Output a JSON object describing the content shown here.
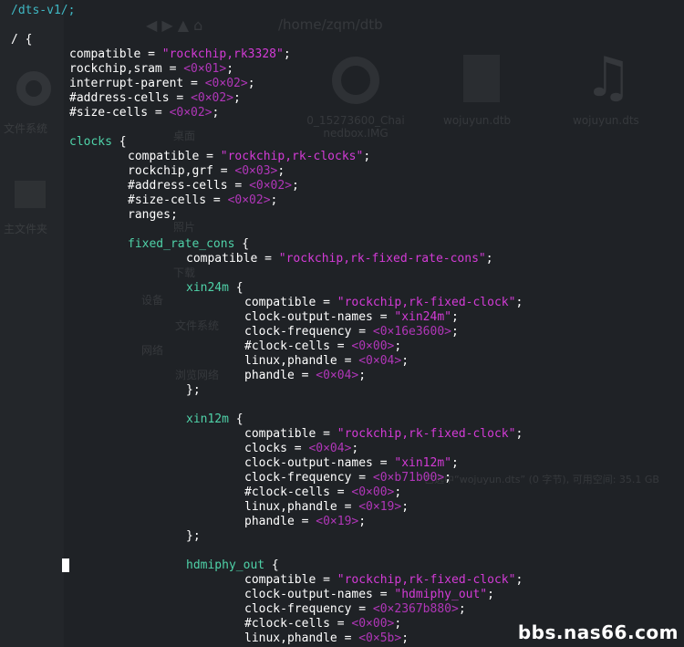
{
  "header_line": "/dts-v1/;",
  "root_open": "/ {",
  "background_ghost": {
    "path": "/home/zqm/dtb",
    "files": [
      "0_15273600_Chai nedbox.IMG",
      "wojuyun.dtb",
      "wojuyun.dts"
    ],
    "sidebar": [
      "文件系统",
      "主文件夹"
    ],
    "places": [
      "桌面",
      "设备",
      "文件系统",
      "网络",
      "浏览网络",
      "照片",
      "下载"
    ],
    "status": "已选中“wojuyun.dts” (0 字节), 可用空间: 35.1 GB"
  },
  "lines": [
    {
      "key": "compatible",
      "val": "\"rockchip,rk3328\"",
      "type": "str"
    },
    {
      "key": "rockchip,sram",
      "val": "<0×01>",
      "type": "num"
    },
    {
      "key": "interrupt-parent",
      "val": "<0×02>",
      "type": "num"
    },
    {
      "key": "#address-cells",
      "val": "<0×02>",
      "type": "num"
    },
    {
      "key": "#size-cells",
      "val": "<0×02>",
      "type": "num"
    },
    {
      "node": "clocks"
    },
    {
      "key": "compatible",
      "val": "\"rockchip,rk-clocks\"",
      "type": "str"
    },
    {
      "key": "rockchip,grf",
      "val": "<0×03>",
      "type": "num"
    },
    {
      "key": "#address-cells",
      "val": "<0×02>",
      "type": "num"
    },
    {
      "key": "#size-cells",
      "val": "<0×02>",
      "type": "num"
    },
    {
      "plain": "ranges;"
    },
    {
      "node": "fixed_rate_cons"
    },
    {
      "key": "compatible",
      "val": "\"rockchip,rk-fixed-rate-cons\"",
      "type": "str"
    },
    {
      "node": "xin24m"
    },
    {
      "key": "compatible",
      "val": "\"rockchip,rk-fixed-clock\"",
      "type": "str"
    },
    {
      "key": "clock-output-names",
      "val": "\"xin24m\"",
      "type": "str"
    },
    {
      "key": "clock-frequency",
      "val": "<0×16e3600>",
      "type": "num"
    },
    {
      "key": "#clock-cells",
      "val": "<0×00>",
      "type": "num"
    },
    {
      "key": "linux,phandle",
      "val": "<0×04>",
      "type": "num"
    },
    {
      "key": "phandle",
      "val": "<0×04>",
      "type": "num"
    },
    {
      "plain": "};"
    },
    {
      "node": "xin12m"
    },
    {
      "key": "compatible",
      "val": "\"rockchip,rk-fixed-clock\"",
      "type": "str"
    },
    {
      "key": "clocks",
      "val": "<0×04>",
      "type": "num"
    },
    {
      "key": "clock-output-names",
      "val": "\"xin12m\"",
      "type": "str"
    },
    {
      "key": "clock-frequency",
      "val": "<0×b71b00>",
      "type": "num"
    },
    {
      "key": "#clock-cells",
      "val": "<0×00>",
      "type": "num"
    },
    {
      "key": "linux,phandle",
      "val": "<0×19>",
      "type": "num"
    },
    {
      "key": "phandle",
      "val": "<0×19>",
      "type": "num"
    },
    {
      "plain": "};"
    },
    {
      "node": "hdmiphy_out"
    },
    {
      "key": "compatible",
      "val": "\"rockchip,rk-fixed-clock\"",
      "type": "str"
    },
    {
      "key": "clock-output-names",
      "val": "\"hdmiphy_out\"",
      "type": "str"
    },
    {
      "key": "clock-frequency",
      "val": "<0×2367b880>",
      "type": "num"
    },
    {
      "key": "#clock-cells",
      "val": "<0×00>",
      "type": "num"
    },
    {
      "key": "linux,phandle",
      "val": "<0×5b>",
      "type": "num"
    }
  ],
  "watermark": "bbs.nas66.com"
}
